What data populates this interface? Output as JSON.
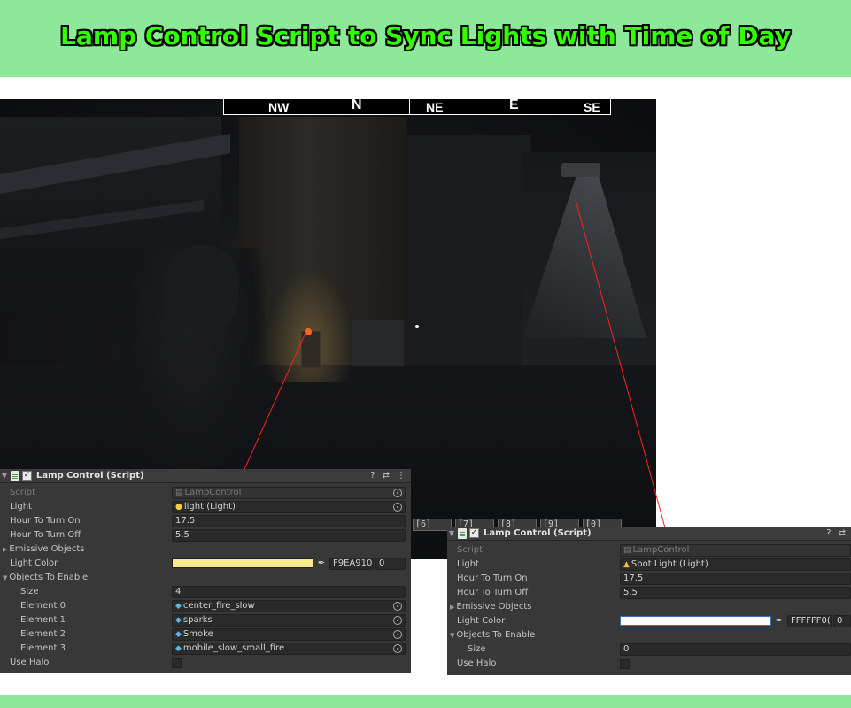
{
  "banner": {
    "title": "Lamp Control Script to Sync Lights with Time of Day"
  },
  "viewport": {
    "compass": [
      "NW",
      "N",
      "NE",
      "E",
      "SE"
    ],
    "hotbar": [
      "[6]",
      "[7]",
      "[8]",
      "[9]",
      "[0]"
    ]
  },
  "inspector_left": {
    "title": "Lamp Control (Script)",
    "rows": {
      "script_label": "Script",
      "script_value": "LampControl",
      "light_label": "Light",
      "light_value": "light (Light)",
      "hour_on_label": "Hour To Turn On",
      "hour_on_value": "17.5",
      "hour_off_label": "Hour To Turn Off",
      "hour_off_value": "5.5",
      "emissive_label": "Emissive Objects",
      "color_label": "Light Color",
      "color_swatch": "#f9ea91",
      "color_hex": "F9EA910(",
      "color_alpha": "0",
      "objects_label": "Objects To Enable",
      "size_label": "Size",
      "size_value": "4",
      "elements": [
        {
          "label": "Element 0",
          "value": "center_fire_slow"
        },
        {
          "label": "Element 1",
          "value": "sparks"
        },
        {
          "label": "Element 2",
          "value": "Smoke"
        },
        {
          "label": "Element 3",
          "value": "mobile_slow_small_fire"
        }
      ],
      "halo_label": "Use Halo"
    }
  },
  "inspector_right": {
    "title": "Lamp Control (Script)",
    "rows": {
      "script_label": "Script",
      "script_value": "LampControl",
      "light_label": "Light",
      "light_value": "Spot Light (Light)",
      "hour_on_label": "Hour To Turn On",
      "hour_on_value": "17.5",
      "hour_off_label": "Hour To Turn Off",
      "hour_off_value": "5.5",
      "emissive_label": "Emissive Objects",
      "color_label": "Light Color",
      "color_swatch": "#ffffff",
      "color_hex": "FFFFFF0(",
      "color_alpha": "0",
      "objects_label": "Objects To Enable",
      "size_label": "Size",
      "size_value": "0",
      "halo_label": "Use Halo"
    }
  },
  "colors": {
    "banner": "#8ee89a",
    "title_text": "#33ff00",
    "pointer_line": "#ff2020",
    "inspector_bg": "#383838"
  }
}
